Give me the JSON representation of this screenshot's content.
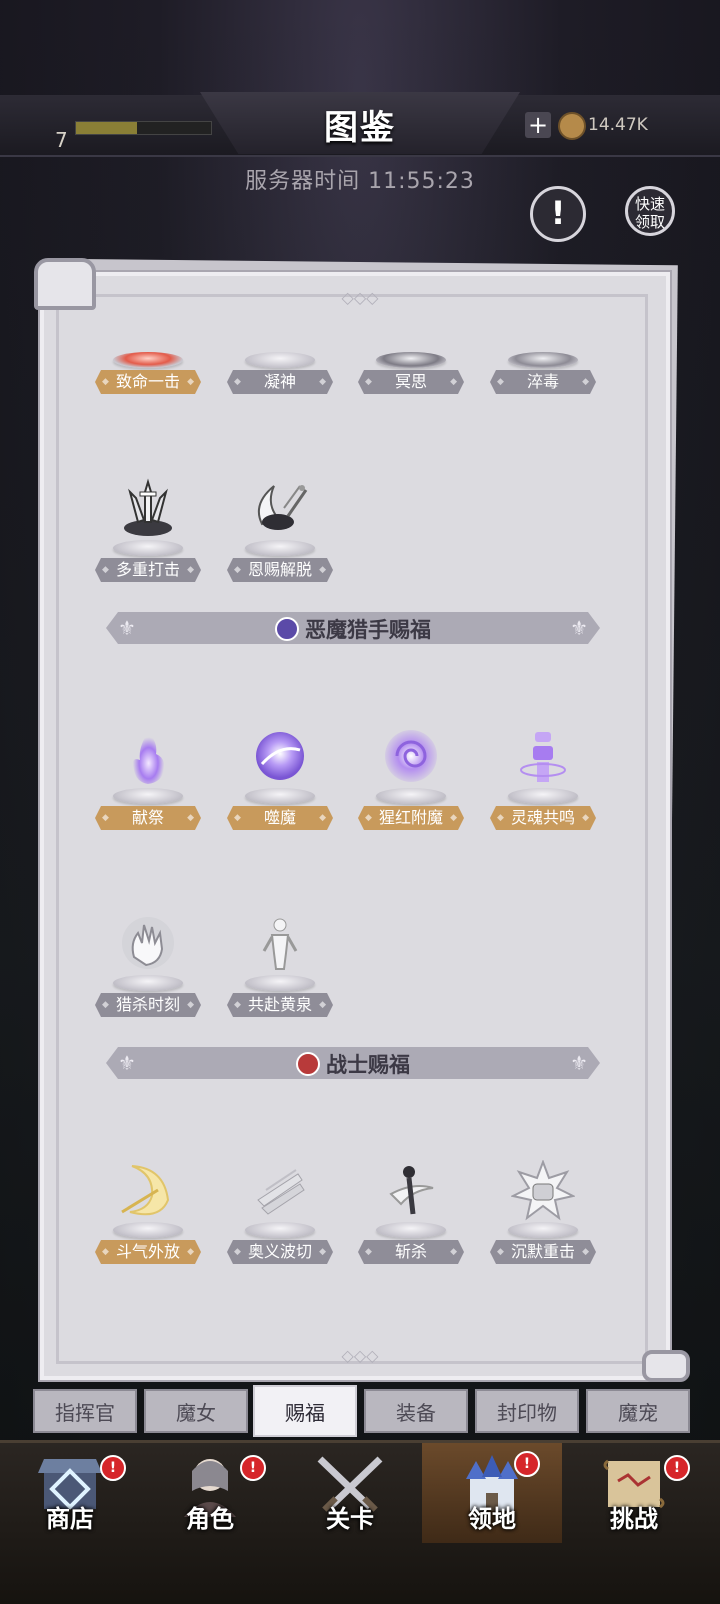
{
  "header": {
    "title": "图鉴",
    "level": "7",
    "coin_value": "14.47K",
    "server_time": "服务器时间 11:55:23",
    "quick_claim": "快速领取"
  },
  "blessings_top": [
    {
      "name": "致命一击",
      "tier": "gold"
    },
    {
      "name": "凝神",
      "tier": "gray"
    },
    {
      "name": "冥思",
      "tier": "gray"
    },
    {
      "name": "淬毒",
      "tier": "gray"
    },
    {
      "name": "多重打击",
      "tier": "gray"
    },
    {
      "name": "恩赐解脱",
      "tier": "gray"
    }
  ],
  "sections": [
    {
      "title": "恶魔猎手赐福",
      "icon_color": "#5b4aa8",
      "items": [
        {
          "name": "献祭",
          "tier": "gold",
          "icon": "purple-flame-icon"
        },
        {
          "name": "噬魔",
          "tier": "gold",
          "icon": "purple-orb-icon"
        },
        {
          "name": "猩红附魔",
          "tier": "gold",
          "icon": "purple-vortex-icon"
        },
        {
          "name": "灵魂共鸣",
          "tier": "gold",
          "icon": "purple-totem-icon"
        },
        {
          "name": "猎杀时刻",
          "tier": "gray",
          "icon": "grasping-hand-icon"
        },
        {
          "name": "共赴黄泉",
          "tier": "gray",
          "icon": "spirit-figure-icon"
        }
      ]
    },
    {
      "title": "战士赐福",
      "icon_color": "#b83a3a",
      "items": [
        {
          "name": "斗气外放",
          "tier": "gold",
          "icon": "gold-crescent-icon"
        },
        {
          "name": "奥义波切",
          "tier": "gray",
          "icon": "blade-wave-icon"
        },
        {
          "name": "斩杀",
          "tier": "gray",
          "icon": "execute-slash-icon"
        },
        {
          "name": "沉默重击",
          "tier": "gray",
          "icon": "fist-impact-icon"
        }
      ]
    }
  ],
  "tabs": [
    "指挥官",
    "魔女",
    "赐福",
    "装备",
    "封印物",
    "魔宠"
  ],
  "active_tab": "赐福",
  "tab_count_hint": "2",
  "nav": [
    {
      "label": "商店"
    },
    {
      "label": "角色"
    },
    {
      "label": "关卡"
    },
    {
      "label": "领地"
    },
    {
      "label": "挑战"
    }
  ],
  "colors": {
    "gold_label": "#c89a5c",
    "gray_label": "#8f8d98",
    "paper": "#dcdbe0"
  }
}
